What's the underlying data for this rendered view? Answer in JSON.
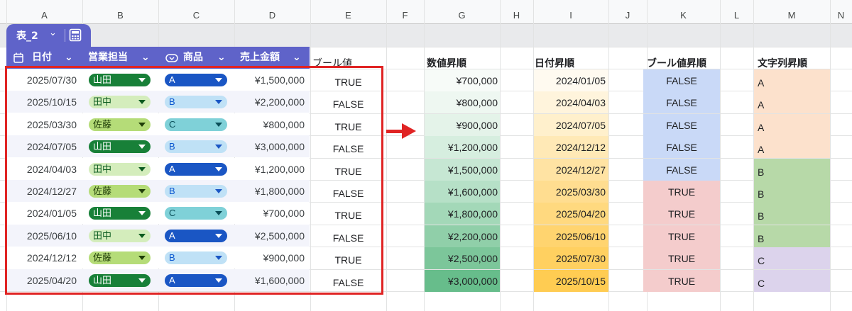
{
  "column_headers": [
    "A",
    "B",
    "C",
    "D",
    "E",
    "F",
    "G",
    "H",
    "I",
    "J",
    "K",
    "L",
    "M",
    "N"
  ],
  "table": {
    "tab_name": "表_2",
    "tab_chevron": "⌄",
    "calc_icon": "calculator-icon",
    "headers": {
      "date": "日付",
      "person": "営業担当",
      "product": "商品",
      "amount": "売上金額"
    },
    "header_icons": {
      "date": "calendar-icon",
      "product": "dropdown-chip-icon"
    },
    "header_chevron": "⌄",
    "rows": [
      {
        "date": "2025/07/30",
        "person": "山田",
        "product": "A",
        "amount": "¥1,500,000"
      },
      {
        "date": "2025/10/15",
        "person": "田中",
        "product": "B",
        "amount": "¥2,200,000"
      },
      {
        "date": "2025/03/30",
        "person": "佐藤",
        "product": "C",
        "amount": "¥800,000"
      },
      {
        "date": "2024/07/05",
        "person": "山田",
        "product": "B",
        "amount": "¥3,000,000"
      },
      {
        "date": "2024/04/03",
        "person": "田中",
        "product": "A",
        "amount": "¥1,200,000"
      },
      {
        "date": "2024/12/27",
        "person": "佐藤",
        "product": "B",
        "amount": "¥1,800,000"
      },
      {
        "date": "2024/01/05",
        "person": "山田",
        "product": "C",
        "amount": "¥700,000"
      },
      {
        "date": "2025/06/10",
        "person": "田中",
        "product": "A",
        "amount": "¥2,500,000"
      },
      {
        "date": "2024/12/12",
        "person": "佐藤",
        "product": "B",
        "amount": "¥900,000"
      },
      {
        "date": "2025/04/20",
        "person": "山田",
        "product": "A",
        "amount": "¥1,600,000"
      }
    ]
  },
  "boolean_column": {
    "header": "ブール値",
    "values": [
      "TRUE",
      "FALSE",
      "TRUE",
      "FALSE",
      "TRUE",
      "FALSE",
      "TRUE",
      "FALSE",
      "TRUE",
      "FALSE"
    ]
  },
  "sorted": {
    "numeric": {
      "header": "数値昇順",
      "values": [
        "¥700,000",
        "¥800,000",
        "¥900,000",
        "¥1,200,000",
        "¥1,500,000",
        "¥1,600,000",
        "¥1,800,000",
        "¥2,200,000",
        "¥2,500,000",
        "¥3,000,000"
      ]
    },
    "dates": {
      "header": "日付昇順",
      "values": [
        "2024/01/05",
        "2024/04/03",
        "2024/07/05",
        "2024/12/12",
        "2024/12/27",
        "2025/03/30",
        "2025/04/20",
        "2025/06/10",
        "2025/07/30",
        "2025/10/15"
      ]
    },
    "boolean": {
      "header": "ブール値昇順",
      "values": [
        "FALSE",
        "FALSE",
        "FALSE",
        "FALSE",
        "FALSE",
        "TRUE",
        "TRUE",
        "TRUE",
        "TRUE",
        "TRUE"
      ]
    },
    "strings": {
      "header": "文字列昇順",
      "values": [
        "A",
        "A",
        "A",
        "A",
        "B",
        "B",
        "B",
        "B",
        "C",
        "C"
      ]
    }
  },
  "colors": {
    "table_header": "#5f63c9",
    "highlight_border": "#e02424",
    "person_yamada": "#188038",
    "person_tanaka": "#d4edbc",
    "person_sato": "#b5dc78",
    "product_a": "#1a56c4",
    "product_b": "#bfe1f6",
    "product_c": "#7fd1d8",
    "bool_false_fill": "#c9d9f7",
    "bool_true_fill": "#f4cccc",
    "string_a_fill": "#fce1cc",
    "string_b_fill": "#b7d9a8",
    "string_c_fill": "#dcd3ec"
  }
}
